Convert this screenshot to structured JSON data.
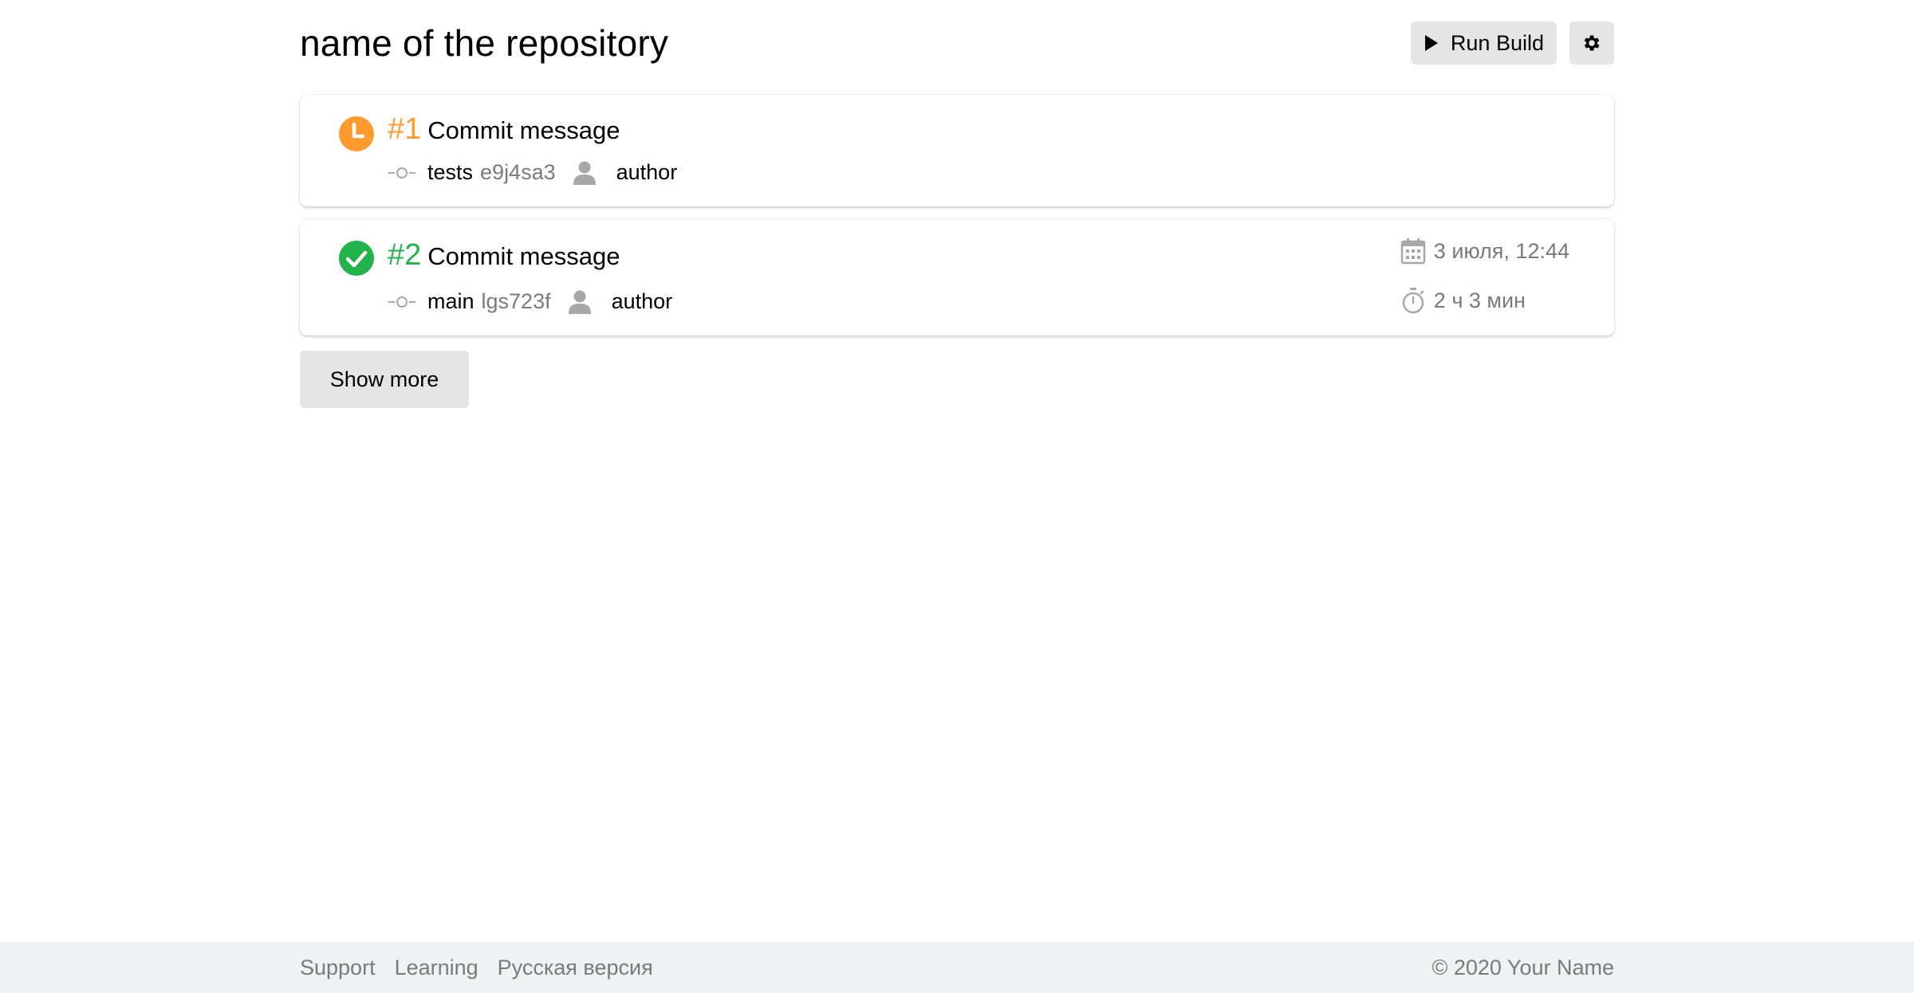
{
  "header": {
    "title": "name of the repository",
    "run_build_label": "Run Build"
  },
  "builds": [
    {
      "status": "pending",
      "status_icon": "clock-icon",
      "number": "#1",
      "message": "Commit message",
      "branch": "tests",
      "hash": "e9j4sa3",
      "author": "author"
    },
    {
      "status": "success",
      "status_icon": "check-circle-icon",
      "number": "#2",
      "message": "Commit message",
      "branch": "main",
      "hash": "lgs723f",
      "author": "author",
      "date": "3 июля, 12:44",
      "duration": "2 ч 3 мин"
    }
  ],
  "show_more_label": "Show more",
  "footer": {
    "links": [
      "Support",
      "Learning",
      "Русская версия"
    ],
    "copyright": "© 2020 Your Name"
  },
  "colors": {
    "pending": "#ff9a2e",
    "success": "#22b34a",
    "muted": "#7a7a7a",
    "button_bg": "#e5e5e5",
    "footer_bg": "#f0f1f3"
  }
}
